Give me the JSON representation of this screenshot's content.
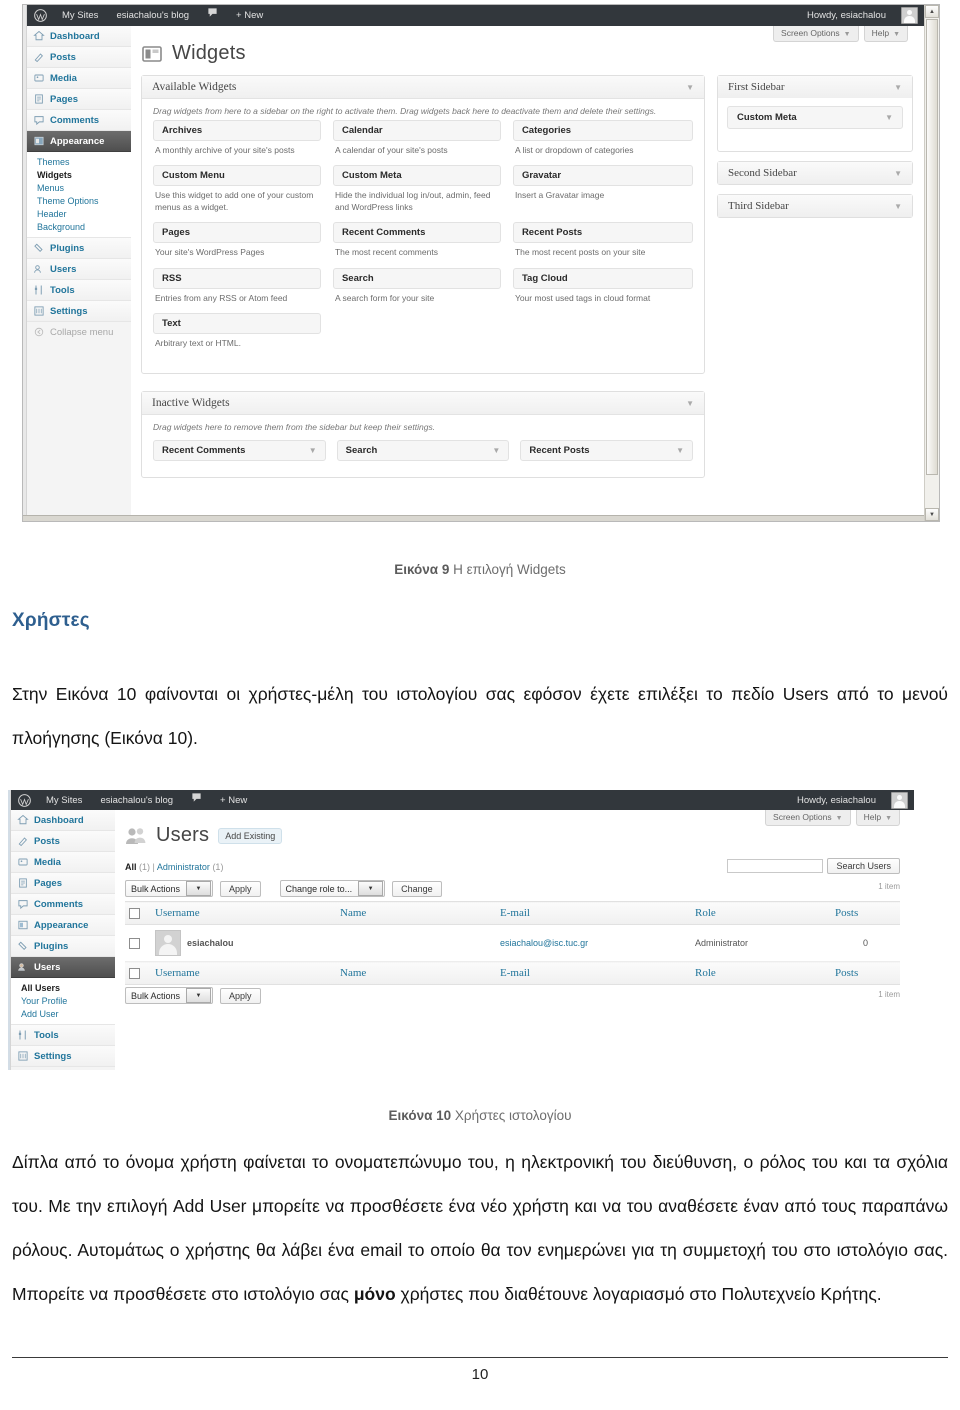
{
  "document": {
    "page_number": "10",
    "heading_users": "Χρήστες",
    "caption9_bold": "Εικόνα 9",
    "caption9_rest": " Η επιλογή Widgets",
    "caption10_bold": "Εικόνα 10",
    "caption10_rest": " Χρήστες ιστολογίου",
    "para1": "Στην Εικόνα 10 φαίνονται οι χρήστες-μέλη του ιστολογίου σας εφόσον έχετε επιλέξει το πεδίο Users από το μενού πλοήγησης (Εικόνα 10).",
    "para2_a": "Δίπλα από το όνομα χρήστη φαίνεται το ονοματεπώνυμο του, η ηλεκτρονική του διεύθυνση, ο ρόλος του και τα σχόλια του. Με την επιλογή Add User μπορείτε να προσθέσετε ένα νέο χρήστη και να του αναθέσετε έναν από τους παραπάνω ρόλους. Αυτομάτως ο χρήστης θα λάβει ένα email το οποίο θα τον ενημερώνει για τη συμμετοχή του στο ιστολόγιο σας.  Μπορείτε να προσθέσετε στο ιστολόγιο σας ",
    "para2_bold": "μόνο",
    "para2_b": " χρήστες που διαθέτουνε λογαριασμό στο Πολυτεχνείο Κρήτης."
  },
  "widgets_screen": {
    "adminbar": {
      "my_sites": "My Sites",
      "blog": "esiachalou's blog",
      "new": "+ New",
      "howdy": "Howdy, esiachalou"
    },
    "menu": [
      {
        "label": "Dashboard",
        "icon": "dashboard-icon"
      },
      {
        "label": "Posts",
        "icon": "posts-icon"
      },
      {
        "label": "Media",
        "icon": "media-icon"
      },
      {
        "label": "Pages",
        "icon": "pages-icon"
      },
      {
        "label": "Comments",
        "icon": "comments-icon"
      },
      {
        "label": "Appearance",
        "icon": "appearance-icon"
      },
      {
        "label": "Plugins",
        "icon": "plugins-icon"
      },
      {
        "label": "Users",
        "icon": "users-icon"
      },
      {
        "label": "Tools",
        "icon": "tools-icon"
      },
      {
        "label": "Settings",
        "icon": "settings-icon"
      },
      {
        "label": "Collapse menu",
        "icon": "collapse-icon"
      }
    ],
    "submenu": [
      "Themes",
      "Widgets",
      "Menus",
      "Theme Options",
      "Header",
      "Background"
    ],
    "screen_options": "Screen Options",
    "help": "Help",
    "page_title": "Widgets",
    "available_panel": {
      "title": "Available Widgets",
      "note": "Drag widgets from here to a sidebar on the right to activate them. Drag widgets back here to deactivate them and delete their settings."
    },
    "available_widgets": [
      {
        "name": "Archives",
        "desc": "A monthly archive of your site's posts"
      },
      {
        "name": "Calendar",
        "desc": "A calendar of your site's posts"
      },
      {
        "name": "Categories",
        "desc": "A list or dropdown of categories"
      },
      {
        "name": "Custom Menu",
        "desc": "Use this widget to add one of your custom menus as a widget."
      },
      {
        "name": "Custom Meta",
        "desc": "Hide the individual log in/out, admin, feed and WordPress links"
      },
      {
        "name": "Gravatar",
        "desc": "Insert a Gravatar image"
      },
      {
        "name": "Pages",
        "desc": "Your site's WordPress Pages"
      },
      {
        "name": "Recent Comments",
        "desc": "The most recent comments"
      },
      {
        "name": "Recent Posts",
        "desc": "The most recent posts on your site"
      },
      {
        "name": "RSS",
        "desc": "Entries from any RSS or Atom feed"
      },
      {
        "name": "Search",
        "desc": "A search form for your site"
      },
      {
        "name": "Tag Cloud",
        "desc": "Your most used tags in cloud format"
      },
      {
        "name": "Text",
        "desc": "Arbitrary text or HTML."
      }
    ],
    "inactive_panel": {
      "title": "Inactive Widgets",
      "note": "Drag widgets here to remove them from the sidebar but keep their settings."
    },
    "inactive_widgets": [
      "Recent Comments",
      "Search",
      "Recent Posts"
    ],
    "sidebars": [
      {
        "title": "First Sidebar",
        "widgets": [
          "Custom Meta"
        ]
      },
      {
        "title": "Second Sidebar",
        "widgets": []
      },
      {
        "title": "Third Sidebar",
        "widgets": []
      }
    ]
  },
  "users_screen": {
    "adminbar": {
      "my_sites": "My Sites",
      "blog": "esiachalou's blog",
      "new": "+ New",
      "howdy": "Howdy, esiachalou"
    },
    "menu": [
      {
        "label": "Dashboard",
        "icon": "dashboard-icon"
      },
      {
        "label": "Posts",
        "icon": "posts-icon"
      },
      {
        "label": "Media",
        "icon": "media-icon"
      },
      {
        "label": "Pages",
        "icon": "pages-icon"
      },
      {
        "label": "Comments",
        "icon": "comments-icon"
      },
      {
        "label": "Appearance",
        "icon": "appearance-icon"
      },
      {
        "label": "Plugins",
        "icon": "plugins-icon"
      },
      {
        "label": "Users",
        "icon": "users-icon"
      },
      {
        "label": "Tools",
        "icon": "tools-icon"
      },
      {
        "label": "Settings",
        "icon": "settings-icon"
      }
    ],
    "submenu": [
      "All Users",
      "Your Profile",
      "Add User"
    ],
    "screen_options": "Screen Options",
    "help": "Help",
    "page_title": "Users",
    "add_existing": "Add Existing",
    "filters": {
      "all_label": "All",
      "all_count": "(1)",
      "sep": "|",
      "admin_label": "Administrator",
      "admin_count": "(1)"
    },
    "search": {
      "value": "",
      "placeholder": "",
      "button": "Search Users"
    },
    "item_count": "1 item",
    "bulk_actions": "Bulk Actions",
    "apply": "Apply",
    "change_role": "Change role to...",
    "change": "Change",
    "columns": [
      "Username",
      "Name",
      "E-mail",
      "Role",
      "Posts"
    ],
    "rows": [
      {
        "username": "esiachalou",
        "name": "",
        "email": "esiachalou@isc.tuc.gr",
        "role": "Administrator",
        "posts": "0"
      }
    ]
  }
}
